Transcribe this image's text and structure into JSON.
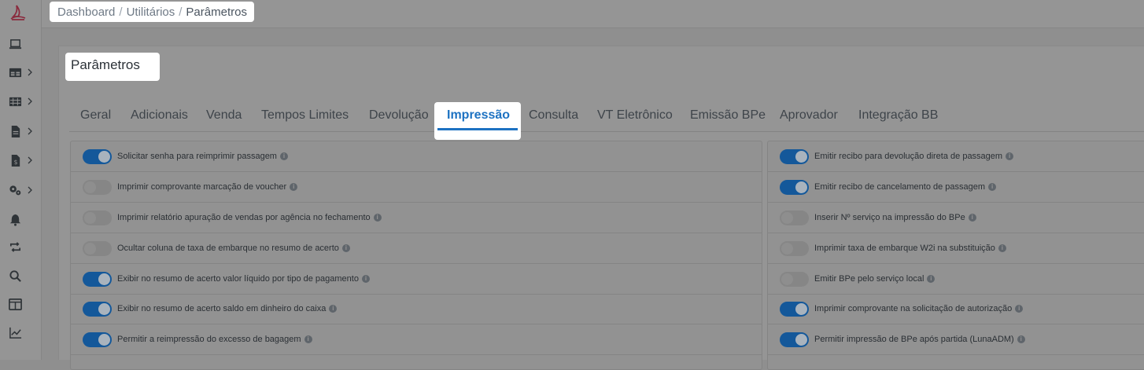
{
  "breadcrumb": {
    "items": [
      "Dashboard",
      "Utilitários",
      "Parâmetros"
    ],
    "separator": "/"
  },
  "page": {
    "title": "Parâmetros"
  },
  "tabs": {
    "items": [
      "Geral",
      "Adicionais",
      "Venda",
      "Tempos Limites",
      "Devolução",
      "Impressão",
      "Consulta",
      "VT Eletrônico",
      "Emissão BPe",
      "Aprovador",
      "Integração BB"
    ],
    "active": "Impressão"
  },
  "sidebar": {
    "icons": [
      "logo-icon",
      "laptop-icon",
      "table-icon",
      "grid-icon",
      "document-icon",
      "invoice-icon",
      "cogs-icon",
      "bell-icon",
      "sync-icon",
      "search-icon",
      "layout-icon",
      "chart-line-icon"
    ]
  },
  "settings": {
    "left": [
      {
        "label": "Solicitar senha para reimprimir passagem",
        "enabled": true
      },
      {
        "label": "Imprimir comprovante marcação de voucher",
        "enabled": false
      },
      {
        "label": "Imprimir relatório apuração de vendas por agência no fechamento",
        "enabled": false
      },
      {
        "label": "Ocultar coluna de taxa de embarque no resumo de acerto",
        "enabled": false
      },
      {
        "label": "Exibir no resumo de acerto valor líquido por tipo de pagamento",
        "enabled": true
      },
      {
        "label": "Exibir no resumo de acerto saldo em dinheiro do caixa",
        "enabled": true
      },
      {
        "label": "Permitir a reimpressão do excesso de bagagem",
        "enabled": true
      }
    ],
    "right": [
      {
        "label": "Emitir recibo para devolução direta de passagem",
        "enabled": true
      },
      {
        "label": "Emitir recibo de cancelamento de passagem",
        "enabled": true
      },
      {
        "label": "Inserir Nº serviço na impressão do BPe",
        "enabled": false
      },
      {
        "label": "Imprimir taxa de embarque W2i na substituição",
        "enabled": false
      },
      {
        "label": "Emitir BPe pelo serviço local",
        "enabled": false
      },
      {
        "label": "Imprimir comprovante na solicitação de autorização",
        "enabled": true
      },
      {
        "label": "Permitir impressão de BPe após partida (LunaADM)",
        "enabled": true
      }
    ]
  },
  "colors": {
    "accent": "#1d72c2",
    "toggle_on": "#14589a",
    "overlay_bg": "#959595"
  }
}
